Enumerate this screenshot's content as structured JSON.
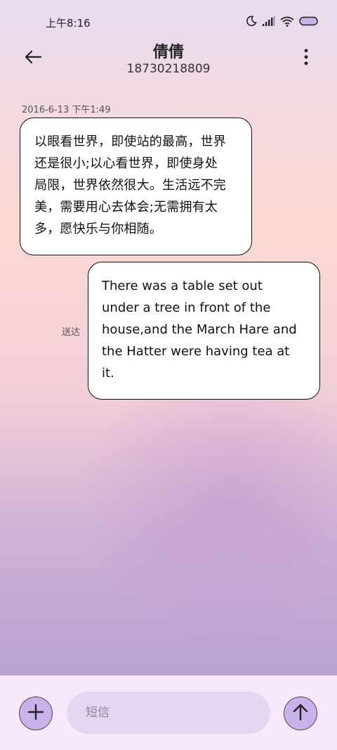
{
  "status_bar": {
    "time": "上午8:16",
    "icons": [
      "moon-icon",
      "signal-icon",
      "wifi-icon",
      "battery-icon"
    ],
    "battery_color": "#c9b2eb"
  },
  "header": {
    "contact_name": "倩倩",
    "contact_number": "18730218809",
    "back_icon": "arrow-left-icon",
    "more_icon": "more-vertical-icon"
  },
  "conversation": {
    "timestamp": "2016-6-13 下午1:49",
    "messages": [
      {
        "direction": "incoming",
        "lines": [
          "以眼看世界，即使站的最高，世界",
          "还是很小;以心看世界，即使身处",
          "局限，世界依然很大。生活远不完",
          "美，需要用心去体会;无需拥有太",
          "多，愿快乐与你相随。"
        ]
      },
      {
        "direction": "outgoing",
        "lines": [
          "There was a table set out",
          "under a tree in front of the",
          "house,and the March Hare and",
          "the Hatter were having tea at",
          "it."
        ],
        "status": "送达"
      }
    ]
  },
  "input_bar": {
    "placeholder": "短信",
    "add_icon": "plus-icon",
    "send_icon": "arrow-up-icon",
    "button_color": "#c9b2eb"
  }
}
